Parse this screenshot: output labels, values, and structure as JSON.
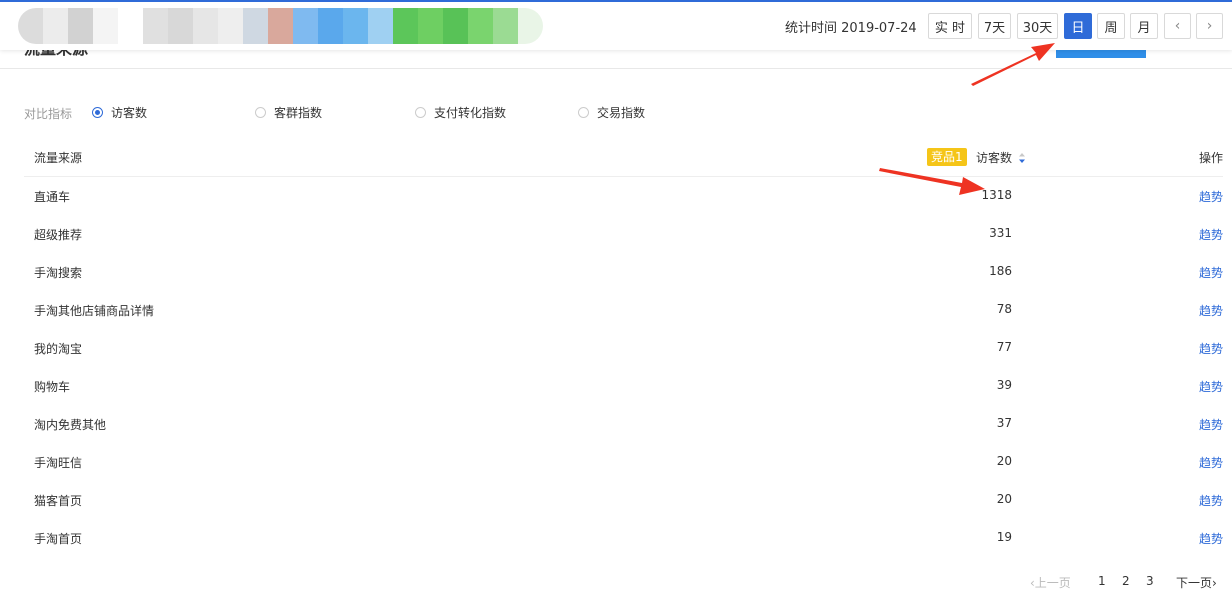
{
  "header": {
    "stat_time_label": "统计时间 2019-07-24",
    "blur_colors": [
      "#dcdcdc",
      "#ececec",
      "#d2d2d2",
      "#f4f4f4",
      "#ffffff",
      "#e0e0e0",
      "#d8d8d8",
      "#e6e6e6",
      "#eeeeee",
      "#cfd8e2",
      "#d9a89c",
      "#7fbaf0",
      "#5aa8ec",
      "#6bb6ee",
      "#9fd0f2",
      "#5cc65a",
      "#6ecf62",
      "#58c257",
      "#7ad46e",
      "#9bdb93",
      "#e9f5e7"
    ],
    "range_buttons": [
      {
        "label": "实 时",
        "active": false
      },
      {
        "label": "7天",
        "active": false
      },
      {
        "label": "30天",
        "active": false
      },
      {
        "label": "日",
        "active": true
      },
      {
        "label": "周",
        "active": false
      },
      {
        "label": "月",
        "active": false
      }
    ],
    "prev_icon": "‹",
    "next_icon": "›"
  },
  "compare": {
    "label": "对比指标",
    "options": [
      {
        "label": "访客数",
        "checked": true
      },
      {
        "label": "客群指数",
        "checked": false
      },
      {
        "label": "支付转化指数",
        "checked": false
      },
      {
        "label": "交易指数",
        "checked": false
      }
    ]
  },
  "table": {
    "col_source": "流量来源",
    "badge": "竞品1",
    "col_visitors": "访客数",
    "col_action": "操作",
    "rows": [
      {
        "source": "直通车",
        "visitors": "1318",
        "action": "趋势"
      },
      {
        "source": "超级推荐",
        "visitors": "331",
        "action": "趋势"
      },
      {
        "source": "手淘搜索",
        "visitors": "186",
        "action": "趋势"
      },
      {
        "source": "手淘其他店铺商品详情",
        "visitors": "78",
        "action": "趋势"
      },
      {
        "source": "我的淘宝",
        "visitors": "77",
        "action": "趋势"
      },
      {
        "source": "购物车",
        "visitors": "39",
        "action": "趋势"
      },
      {
        "source": "淘内免费其他",
        "visitors": "37",
        "action": "趋势"
      },
      {
        "source": "手淘旺信",
        "visitors": "20",
        "action": "趋势"
      },
      {
        "source": "猫客首页",
        "visitors": "20",
        "action": "趋势"
      },
      {
        "source": "手淘首页",
        "visitors": "19",
        "action": "趋势"
      }
    ]
  },
  "pagination": {
    "prev": "‹上一页",
    "pages": [
      "1",
      "2",
      "3"
    ],
    "next": "下一页›"
  },
  "colors": {
    "accent": "#2f6bd8",
    "badge": "#f5c518",
    "arrow": "#ee3322"
  }
}
